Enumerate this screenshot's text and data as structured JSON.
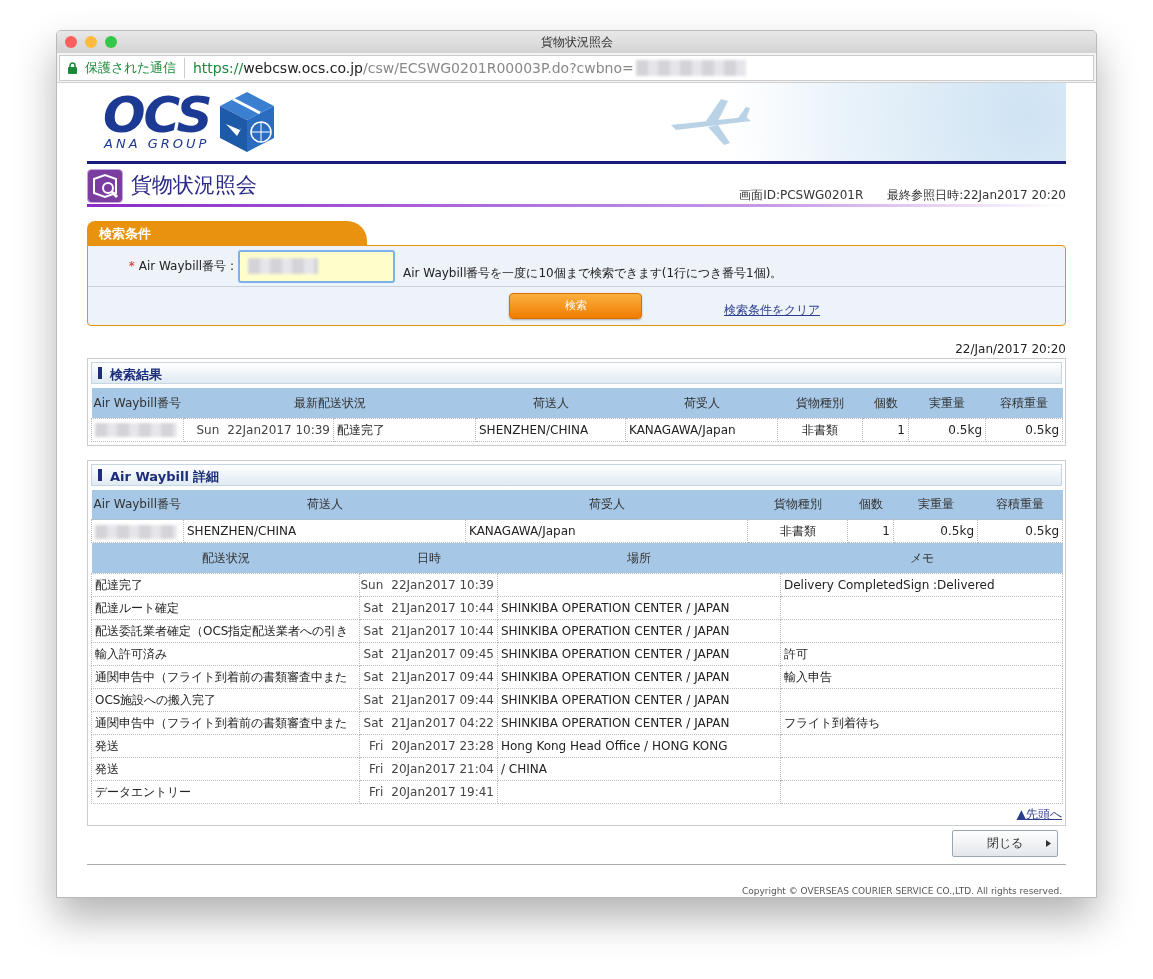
{
  "window": {
    "title": "貨物状況照会"
  },
  "address_bar": {
    "security_label": "保護された通信",
    "url_scheme": "https://",
    "url_host": "webcsw.ocs.co.jp",
    "url_path": "/csw/ECSWG0201R00003P.do?cwbno="
  },
  "header": {
    "logo_text": "OCS",
    "logo_subtext": "ANA GROUP",
    "page_title": "貨物状況照会",
    "screen_id": "画面ID:PCSWG0201R",
    "last_reference": "最終参照日時:22Jan2017 20:20"
  },
  "search": {
    "tab_label": "検索条件",
    "required_mark": "*",
    "field_label": "Air Waybill番号 :",
    "hint": "Air Waybill番号を一度に10個まで検索できます(1行につき番号1個)。",
    "search_button": "検索",
    "clear_link": "検索条件をクリア"
  },
  "result_time": "22/Jan/2017 20:20",
  "results": {
    "title": "検索結果",
    "columns": [
      "Air Waybill番号",
      "最新配送状況",
      "荷送人",
      "荷受人",
      "貨物種別",
      "個数",
      "実重量",
      "容積重量"
    ],
    "rows": [
      {
        "day": "Sun",
        "datetime": "22Jan2017 10:39",
        "status": "配達完了",
        "shipper": "SHENZHEN/CHINA",
        "consignee": "KANAGAWA/Japan",
        "cargo_type": "非書類",
        "pieces": "1",
        "actual_weight": "0.5kg",
        "volume_weight": "0.5kg"
      }
    ]
  },
  "detail": {
    "title": "Air Waybill 詳細",
    "columns": [
      "Air Waybill番号",
      "荷送人",
      "荷受人",
      "貨物種別",
      "個数",
      "実重量",
      "容積重量"
    ],
    "row": {
      "shipper": "SHENZHEN/CHINA",
      "consignee": "KANAGAWA/Japan",
      "cargo_type": "非書類",
      "pieces": "1",
      "actual_weight": "0.5kg",
      "volume_weight": "0.5kg"
    },
    "history_columns": [
      "配送状況",
      "日時",
      "場所",
      "メモ"
    ],
    "history": [
      {
        "status": "配達完了",
        "day": "Sun",
        "datetime": "22Jan2017 10:39",
        "memo": "Delivery CompletedSign :Delivered"
      },
      {
        "status": "配達ルート確定",
        "day": "Sat",
        "datetime": "21Jan2017 10:44",
        "location": "SHINKIBA OPERATION CENTER / JAPAN"
      },
      {
        "status": "配送委託業者確定（OCS指定配送業者への引き",
        "day": "Sat",
        "datetime": "21Jan2017 10:44",
        "location": "SHINKIBA OPERATION CENTER / JAPAN"
      },
      {
        "status": "輸入許可済み",
        "day": "Sat",
        "datetime": "21Jan2017 09:45",
        "location": "SHINKIBA OPERATION CENTER / JAPAN",
        "memo": "許可"
      },
      {
        "status": "通関申告中（フライト到着前の書類審査中また",
        "day": "Sat",
        "datetime": "21Jan2017 09:44",
        "location": "SHINKIBA OPERATION CENTER / JAPAN",
        "memo": "輸入申告"
      },
      {
        "status": "OCS施設への搬入完了",
        "day": "Sat",
        "datetime": "21Jan2017 09:44",
        "location": "SHINKIBA OPERATION CENTER / JAPAN"
      },
      {
        "status": "通関申告中（フライト到着前の書類審査中また",
        "day": "Sat",
        "datetime": "21Jan2017 04:22",
        "location": "SHINKIBA OPERATION CENTER / JAPAN",
        "memo": "フライト到着待ち"
      },
      {
        "status": "発送",
        "day": "Fri",
        "datetime": "20Jan2017 23:28",
        "location": "Hong Kong Head Office / HONG KONG"
      },
      {
        "status": "発送",
        "day": "Fri",
        "datetime": "20Jan2017 21:04",
        "location": " / CHINA"
      },
      {
        "status": "データエントリー",
        "day": "Fri",
        "datetime": "20Jan2017 19:41"
      }
    ]
  },
  "top_link": "▲先頭へ",
  "close_button": "閉じる",
  "copyright": "Copyright © OVERSEAS COURIER SERVICE CO.,LTD. All rights reserved."
}
